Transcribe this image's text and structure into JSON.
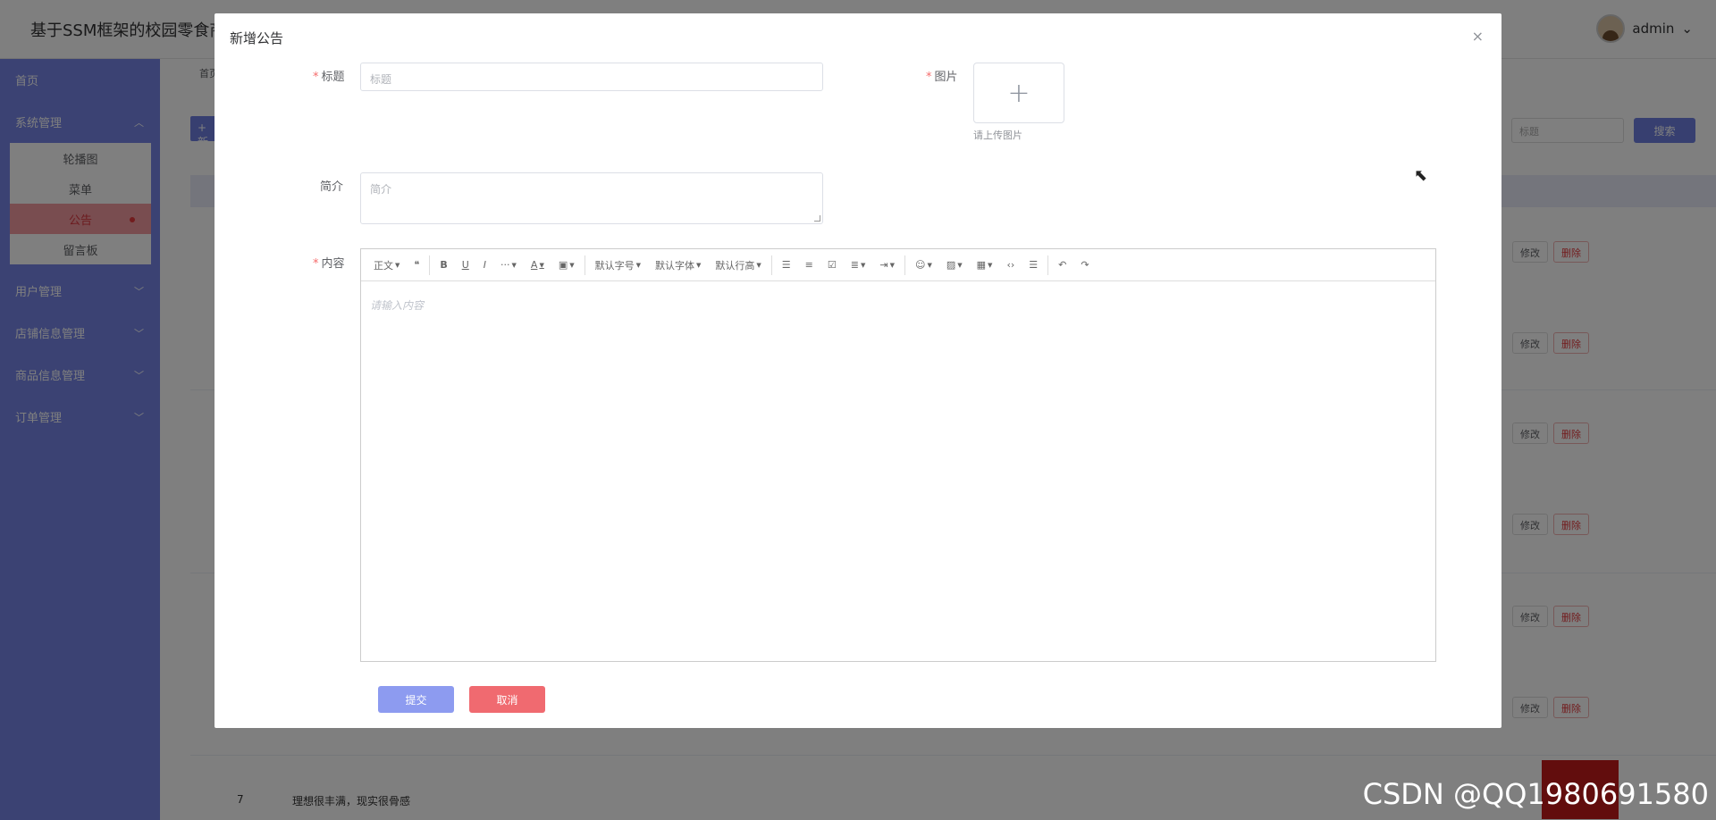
{
  "app": {
    "title": "基于SSM框架的校园零食商",
    "user": "admin"
  },
  "sidebar": {
    "items": [
      {
        "label": "首页"
      },
      {
        "label": "系统管理"
      },
      {
        "label": "用户管理"
      },
      {
        "label": "店铺信息管理"
      },
      {
        "label": "商品信息管理"
      },
      {
        "label": "订单管理"
      }
    ],
    "submenu": [
      {
        "label": "轮播图"
      },
      {
        "label": "菜单"
      },
      {
        "label": "公告"
      },
      {
        "label": "留言板"
      }
    ]
  },
  "background": {
    "breadcrumb": "首页",
    "add_label": "+ 新",
    "search_placeholder": "标题",
    "search_label": "搜索",
    "edit_label": "修改",
    "delete_label": "删除",
    "last_row": {
      "index": "7",
      "title": "理想很丰满，现实很骨感"
    }
  },
  "dialog": {
    "title": "新增公告",
    "close": "×",
    "title_label": "标题",
    "title_placeholder": "标题",
    "image_label": "图片",
    "upload_plus": "+",
    "upload_hint": "请上传图片",
    "intro_label": "简介",
    "intro_placeholder": "简介",
    "content_label": "内容",
    "editor_placeholder": "请输入内容",
    "toolbar": {
      "paragraph": "正文",
      "font_size": "默认字号",
      "font_family": "默认字体",
      "line_height": "默认行高"
    },
    "submit": "提交",
    "cancel": "取消"
  },
  "watermark": "CSDN @QQ1980691580"
}
